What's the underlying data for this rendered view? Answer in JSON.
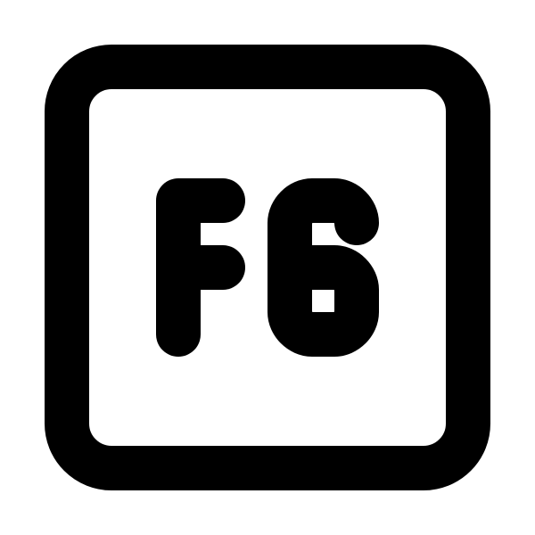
{
  "icon": {
    "name": "f6-key-icon",
    "label": "F6",
    "stroke_color": "#000000",
    "background_color": "#ffffff"
  }
}
